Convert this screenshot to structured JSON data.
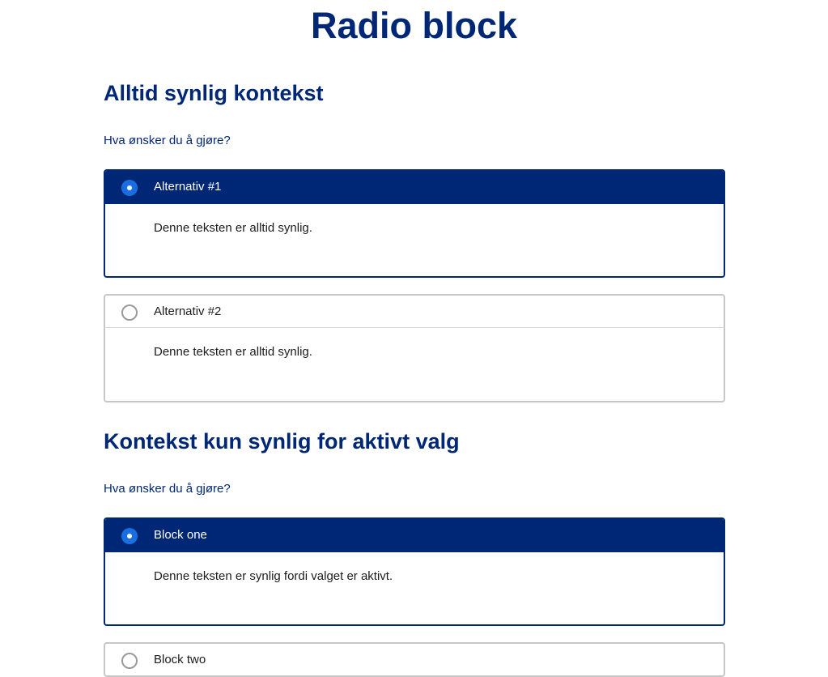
{
  "page": {
    "title": "Radio block"
  },
  "section1": {
    "title": "Alltid synlig kontekst",
    "question": "Hva ønsker du å gjøre?",
    "options": [
      {
        "label": "Alternativ #1",
        "text": "Denne teksten er alltid synlig.",
        "selected": true
      },
      {
        "label": "Alternativ #2",
        "text": "Denne teksten er alltid synlig.",
        "selected": false
      }
    ]
  },
  "section2": {
    "title": "Kontekst kun synlig for aktivt valg",
    "question": "Hva ønsker du å gjøre?",
    "options": [
      {
        "label": "Block one",
        "text": "Denne teksten er synlig fordi valget er aktivt.",
        "selected": true
      },
      {
        "label": "Block two",
        "selected": false
      }
    ]
  },
  "colors": {
    "primary": "#002776",
    "radio_active": "#1a6fe0",
    "border": "#c7c7c7"
  },
  "icons": {
    "radio_selected": "radio-selected-icon",
    "radio_unselected": "radio-unselected-icon"
  }
}
